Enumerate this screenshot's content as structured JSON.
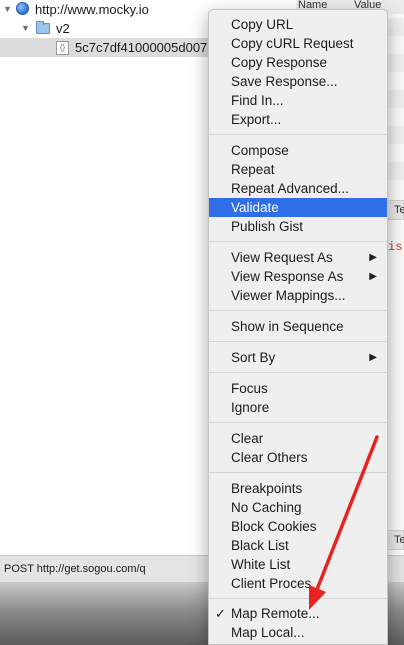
{
  "tree": {
    "root_label": "http://www.mocky.io",
    "child_label": "v2",
    "selected_label": "5c7c7df41000005d007"
  },
  "table": {
    "col_name": "Name",
    "col_value": "Value",
    "right_fragment_1": "Te",
    "right_fragment_2": "Te",
    "red_fragment": "is"
  },
  "status_bar": {
    "text": "POST http://get.sogou.com/q"
  },
  "context_menu": {
    "items": [
      {
        "label": "Copy URL"
      },
      {
        "label": "Copy cURL Request"
      },
      {
        "label": "Copy Response"
      },
      {
        "label": "Save Response..."
      },
      {
        "label": "Find In..."
      },
      {
        "label": "Export..."
      },
      {
        "label": "Compose"
      },
      {
        "label": "Repeat"
      },
      {
        "label": "Repeat Advanced..."
      },
      {
        "label": "Validate",
        "highlighted": true
      },
      {
        "label": "Publish Gist"
      },
      {
        "label": "View Request As",
        "submenu": true
      },
      {
        "label": "View Response As",
        "submenu": true
      },
      {
        "label": "Viewer Mappings..."
      },
      {
        "label": "Show in Sequence"
      },
      {
        "label": "Sort By",
        "submenu": true
      },
      {
        "label": "Focus"
      },
      {
        "label": "Ignore"
      },
      {
        "label": "Clear"
      },
      {
        "label": "Clear Others"
      },
      {
        "label": "Breakpoints"
      },
      {
        "label": "No Caching"
      },
      {
        "label": "Block Cookies"
      },
      {
        "label": "Black List"
      },
      {
        "label": "White List"
      },
      {
        "label": "Client Proces"
      },
      {
        "label": "Map Remote...",
        "checked": true
      },
      {
        "label": "Map Local..."
      }
    ],
    "submenu_glyph": "▶",
    "check_glyph": "✓"
  },
  "colors": {
    "highlight": "#2f6ee6",
    "annotation_arrow": "#e8231f"
  },
  "icons": {
    "root": "globe-icon",
    "child": "folder-icon",
    "selected": "json-file-icon"
  }
}
